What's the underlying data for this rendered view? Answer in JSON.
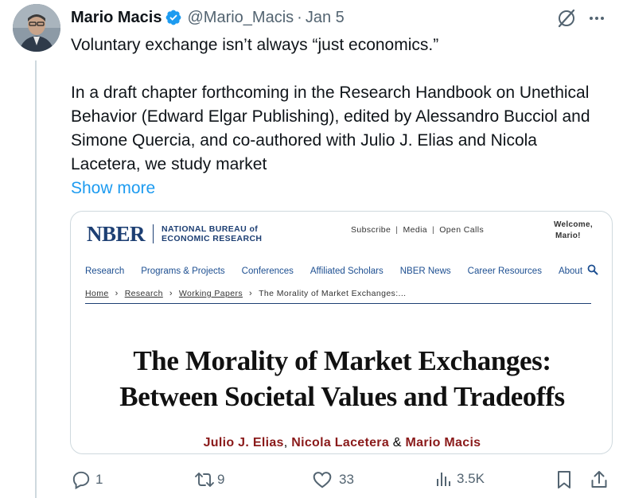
{
  "tweet": {
    "author_name": "Mario Macis",
    "handle": "@Mario_Macis",
    "separator": "·",
    "date": "Jan 5",
    "text_line1": "Voluntary exchange isn’t always “just economics.”",
    "text_para2": "In a draft chapter forthcoming in the Research Handbook on Unethical Behavior (Edward Elgar Publishing), edited by Alessandro Bucciol and Simone Quercia, and co-authored with Julio J. Elias and Nicola Lacetera, we study market",
    "show_more": "Show more"
  },
  "card": {
    "logo": "NBER",
    "org_line1": "NATIONAL BUREAU of",
    "org_line2": "ECONOMIC RESEARCH",
    "util_links": [
      "Subscribe",
      "Media",
      "Open Calls"
    ],
    "util_sep": "|",
    "welcome_line1": "Welcome,",
    "welcome_line2": "Mario!",
    "nav": [
      "Research",
      "Programs & Projects",
      "Conferences",
      "Affiliated Scholars",
      "NBER News",
      "Career Resources",
      "About"
    ],
    "breadcrumbs": [
      "Home",
      "Research",
      "Working Papers",
      "The Morality of Market Exchanges:..."
    ],
    "crumb_sep": "›",
    "title_line1": "The Morality of Market Exchanges:",
    "title_line2": "Between Societal Values and Tradeoffs",
    "authors": [
      "Julio J. Elias",
      "Nicola Lacetera",
      "Mario Macis"
    ],
    "author_sep1": ",",
    "author_sep2": "&"
  },
  "actions": {
    "replies": "1",
    "reposts": "9",
    "likes": "33",
    "views": "3.5K"
  },
  "colors": {
    "accent": "#1d9bf0",
    "secondary_text": "#536471",
    "nber_blue": "#1d3f73",
    "author_red": "#8a1a1a"
  },
  "icons": {
    "verified": "verified-badge-icon",
    "grok": "grok-icon",
    "more": "more-icon",
    "reply": "reply-icon",
    "repost": "repost-icon",
    "like": "heart-icon",
    "views": "views-chart-icon",
    "bookmark": "bookmark-icon",
    "share": "share-icon"
  }
}
